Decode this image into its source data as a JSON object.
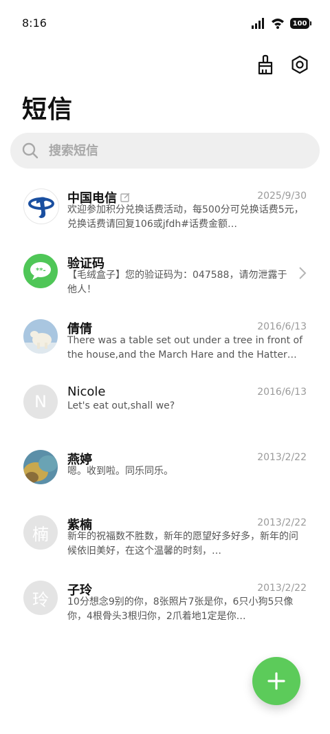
{
  "status": {
    "time": "8:16",
    "battery": "100"
  },
  "header": {
    "title": "短信"
  },
  "search": {
    "placeholder": "搜索短信"
  },
  "conversations": [
    {
      "name": "中国电信",
      "date": "2025/9/30",
      "preview": "欢迎参加积分兑换话费活动，每500分可兑换话费5元，兑换话费请回复106或jfdh#话费金额…",
      "avatar": "china-telecom-logo"
    },
    {
      "name": "验证码",
      "date": "",
      "preview": "【毛绒盒子】您的验证码为：047588，请勿泄露于他人！",
      "avatar": "verification-chat-icon"
    },
    {
      "name": "倩倩",
      "date": "2016/6/13",
      "preview": "There was a table set out under a tree in front of the house,and the March Hare and the Hatter were hav…",
      "avatar": "polar-bear-photo"
    },
    {
      "name": "Nicole",
      "date": "2016/6/13",
      "preview": "Let's eat out,shall we?",
      "avatar_letter": "N"
    },
    {
      "name": "燕婷",
      "date": "2013/2/22",
      "preview": "嗯。收到啦。同乐同乐。",
      "avatar": "landscape-photo"
    },
    {
      "name": "紫楠",
      "date": "2013/2/22",
      "preview": "新年的祝福数不胜数，新年的愿望好多好多，新年的问候依旧美好，在这个温馨的时刻，…",
      "avatar_letter": "楠"
    },
    {
      "name": "子玲",
      "date": "2013/2/22",
      "preview": "10分想念9别的你，8张照片7张是你，6只小狗5只像你，4根骨头3根归你，2爪着地1定是你…",
      "avatar_letter": "玲"
    }
  ],
  "colors": {
    "accent": "#5ccb5a",
    "telecom_blue": "#1a4fa0"
  }
}
